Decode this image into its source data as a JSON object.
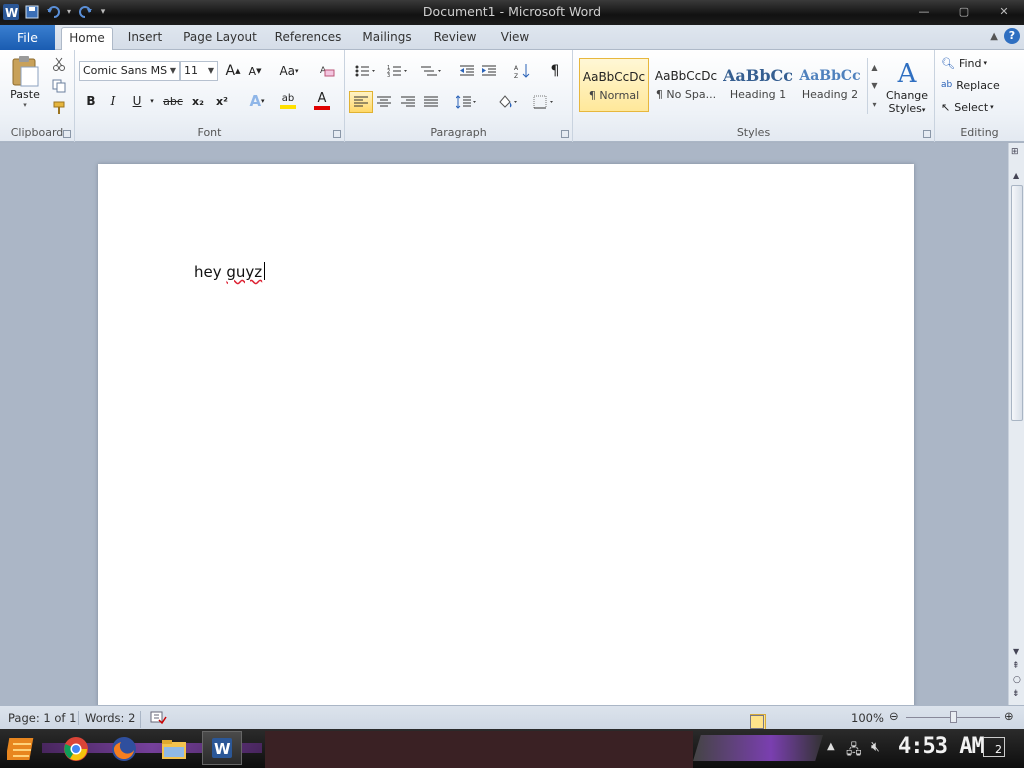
{
  "window": {
    "title": "Document1 - Microsoft Word"
  },
  "tabs": {
    "file": "File",
    "items": [
      "Home",
      "Insert",
      "Page Layout",
      "References",
      "Mailings",
      "Review",
      "View"
    ]
  },
  "clipboard": {
    "paste": "Paste",
    "label": "Clipboard"
  },
  "font": {
    "name": "Comic Sans MS",
    "size": "11",
    "change_case": "Aa",
    "label": "Font",
    "bold": "B",
    "italic": "I",
    "underline": "U",
    "strike": "abc",
    "subscript": "x₂",
    "superscript": "x²",
    "grow": "A",
    "shrink": "A",
    "highlight": "ab",
    "color": "A"
  },
  "paragraph": {
    "label": "Paragraph",
    "show_marks": "¶"
  },
  "styles": {
    "label": "Styles",
    "items": [
      {
        "sample": "AaBbCcDc",
        "name": "¶ Normal"
      },
      {
        "sample": "AaBbCcDc",
        "name": "¶ No Spa..."
      },
      {
        "sample": "AaBbCc",
        "name": "Heading 1"
      },
      {
        "sample": "AaBbCc",
        "name": "Heading 2"
      }
    ],
    "change_label_1": "Change",
    "change_label_2": "Styles"
  },
  "editing": {
    "label": "Editing",
    "find": "Find",
    "replace": "Replace",
    "select": "Select"
  },
  "document": {
    "text_before": "hey ",
    "text_misspelled": "guyz"
  },
  "status": {
    "page": "Page: 1 of 1",
    "words": "Words: 2",
    "zoom": "100%"
  },
  "taskbar": {
    "clock": "4:53 AM",
    "notifications": "2"
  },
  "colors": {
    "accent": "#2b5797",
    "file_tab": "#1a5cb1",
    "highlight": "#ffe000",
    "font_color": "#e00000"
  }
}
